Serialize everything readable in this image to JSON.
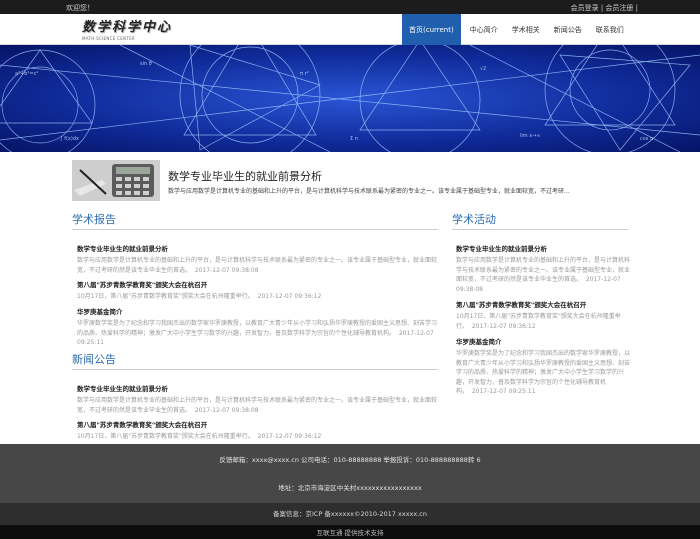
{
  "topbar": {
    "welcome": "欢迎您！",
    "login": "会员登录",
    "separator": " | ",
    "register": "会员注册",
    "trail": " |"
  },
  "logo": {
    "main_text": "数学科学中心",
    "sub_text": "MATH SCIENCE CENTER"
  },
  "nav": {
    "items": [
      {
        "label": "首页(current)"
      },
      {
        "label": "中心简介"
      },
      {
        "label": "学术相关"
      },
      {
        "label": "新闻公告"
      },
      {
        "label": "联系我们"
      }
    ]
  },
  "intro": {
    "title": "数学专业毕业生的就业前景分析",
    "desc": "数学与应用数学是计算机专业的基础和上升的平台，是与计算机科学与技术联系最为紧密的专业之一。该专业属于基础型专业，就业面较宽，不过考研..."
  },
  "academic_reports": {
    "heading": "学术报告",
    "articles": [
      {
        "title": "数学专业毕业生的就业前景分析",
        "body": "数学与应用数学是计算机专业的基础和上升的平台，是与计算机科学与技术联系最为紧密的专业之一。该专业属于基础型专业，就业面较宽，不过考研的然是该专业毕业生的首选。",
        "date": "2017-12-07 09:38:08"
      },
      {
        "title": "第八届\"苏步青数学教育奖\"颁奖大会在杭召开",
        "body": "10月17日，第八届\"苏步青数学教育奖\"颁奖大会在杭州隆重举行。",
        "date": "2017-12-07 09:36:12"
      },
      {
        "title": "华罗庚基金简介",
        "body": "华罗庚数学奖是为了纪念和学习我国杰出的数学家华罗庚教授，以教育广大青少年从小学习和弘扬华罗庚教授的爱国主义思想、刻苦学习的品质、热爱科学的精神；激发广大中小学生学习数学的兴趣，开发智力，普及数学科学为宗旨的个性化辅导教育机构。",
        "date": "2017-12-07 09:25:11"
      }
    ]
  },
  "news": {
    "heading": "新闻公告",
    "articles": [
      {
        "title": "数学专业毕业生的就业前景分析",
        "body": "数学与应用数学是计算机专业的基础和上升的平台，是与计算机科学与技术联系最为紧密的专业之一。该专业属于基础型专业，就业面较宽，不过考研的然是该专业毕业生的首选。",
        "date": "2017-12-07 09:38:08"
      },
      {
        "title": "第八届\"苏步青数学教育奖\"颁奖大会在杭召开",
        "body": "10月17日，第八届\"苏步青数学教育奖\"颁奖大会在杭州隆重举行。",
        "date": "2017-12-07 09:36:12"
      }
    ]
  },
  "academic_activities": {
    "heading": "学术活动",
    "articles": [
      {
        "title": "数学专业毕业生的就业前景分析",
        "body": "数学与应用数学是计算机专业的基础和上升的平台，是与计算机科学与技术联系最为紧密的专业之一。该专业属于基础型专业，就业面较宽，不过考研的然是该专业毕业生的首选。",
        "date": "2017-12-07 09:38:08"
      },
      {
        "title": "第八届\"苏步青数学教育奖\"颁奖大会在杭召开",
        "body": "10月17日，第八届\"苏步青数学教育奖\"颁奖大会在杭州隆重举行。",
        "date": "2017-12-07 09:36:12"
      },
      {
        "title": "华罗庚基金简介",
        "body": "华罗庚数学奖是为了纪念和学习我国杰出的数学家华罗庚教授，以教育广大青少年从小学习和弘扬华罗庚教授的爱国主义思想、刻苦学习的品质、热爱科学的精神；激发广大中小学生学习数学的兴趣，开发智力，普及数学科学为宗旨的个性化辅导教育机构。",
        "date": "2017-12-07 09:25:11"
      }
    ]
  },
  "footer": {
    "contact": "反馈邮箱：xxxx@xxxx.cn    公司电话：010-88888888    举报投诉：010-888888888转 6",
    "address": "地址：北京市海淀区中关村xxxxxxxxxxxxxxxxx",
    "copyright": "备案信息：京ICP 备xxxxxx©2010-2017 xxxxx.cn",
    "support": "互联互通 提供技术支持"
  },
  "colors": {
    "accent": "#2c6cb2",
    "nav_active": "#1f5fae",
    "banner": "#0b1f7a",
    "footer": "#474747"
  }
}
